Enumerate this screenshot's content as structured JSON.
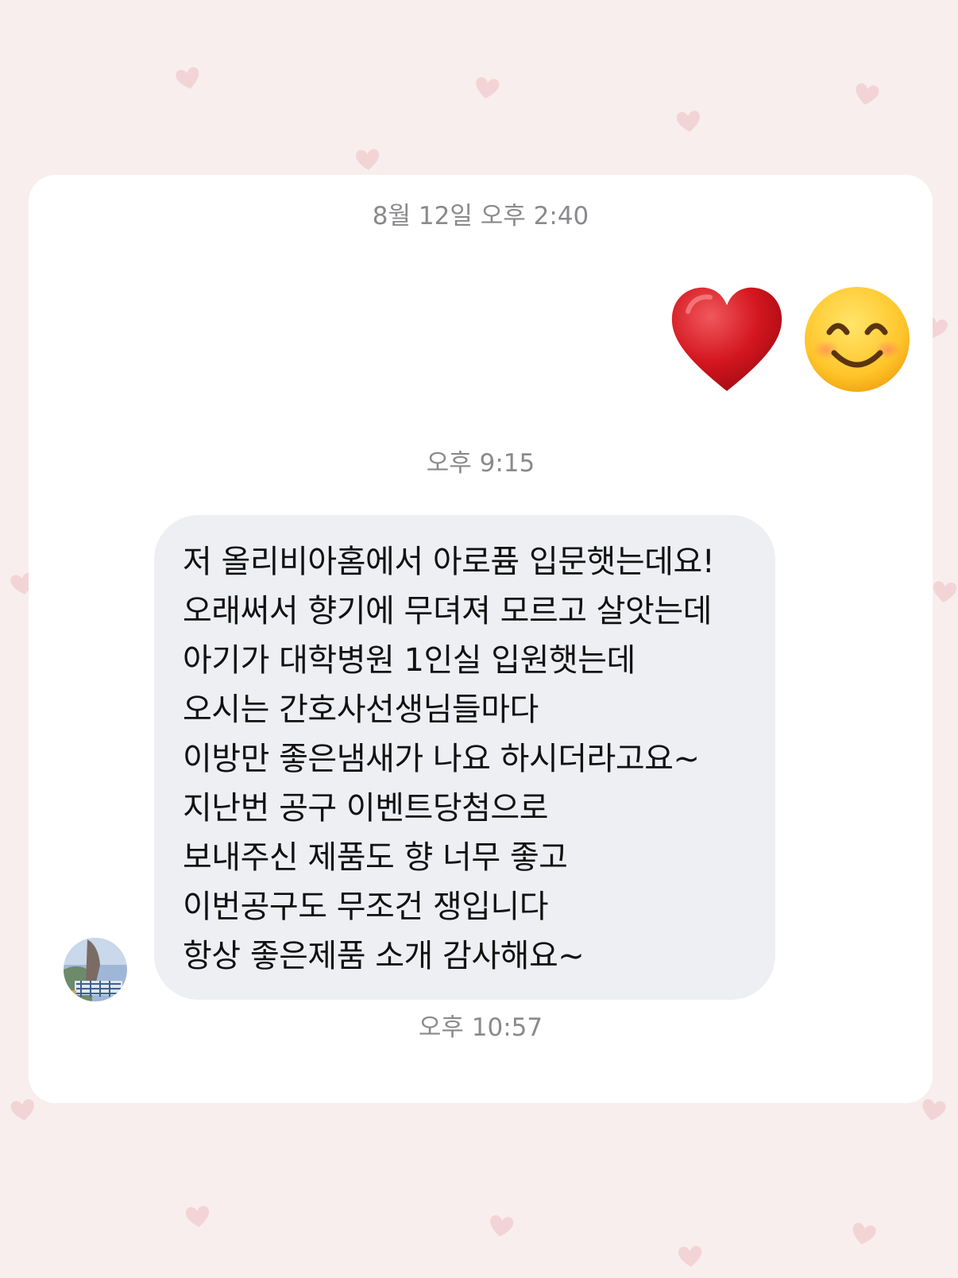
{
  "conversation": {
    "timestamps": [
      "8월 12일 오후 2:40",
      "오후 9:15",
      "오후 10:57"
    ],
    "sent_reaction": {
      "emojis": [
        "red-heart-icon",
        "smiling-face-icon"
      ]
    },
    "received_message": {
      "lines": [
        "저 올리비아홈에서 아로퓸 입문햇는데요!",
        "오래써서 향기에 무뎌져 모르고 살앗는데",
        "아기가 대학병원 1인실 입원햇는데",
        "오시는 간호사선생님들마다",
        "이방만 좋은냄새가 나요 하시더라고요~",
        "지난번 공구 이벤트당첨으로",
        "보내주신 제품도 향 너무 좋고",
        "이번공구도 무조건 쟁입니다",
        "항상 좋은제품 소개 감사해요~"
      ]
    }
  },
  "colors": {
    "background": "#f8eeee",
    "card": "#ffffff",
    "bubble": "#eeeff3",
    "timestamp_text": "#8a8a8e",
    "message_text": "#111111",
    "decor_heart": "#f3d4d6"
  }
}
